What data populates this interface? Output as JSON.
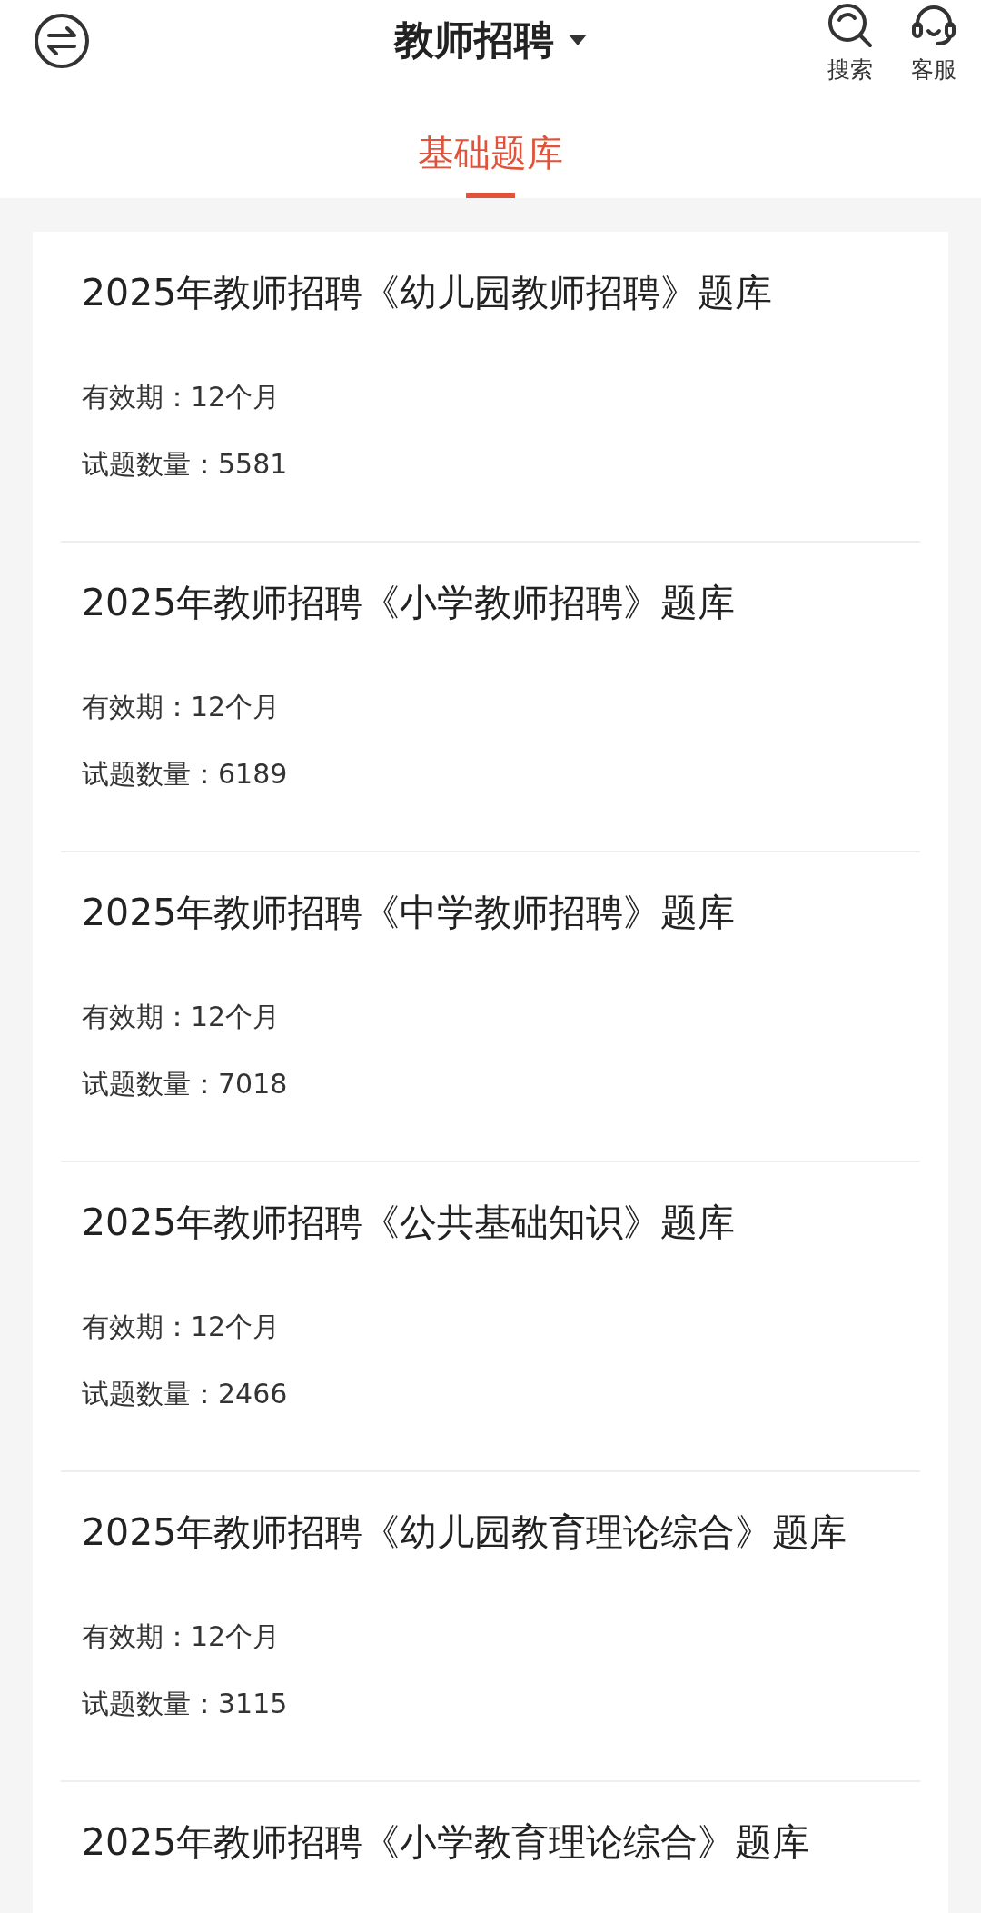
{
  "header": {
    "title": "教师招聘",
    "actions": [
      {
        "kind": "search",
        "label": "搜索"
      },
      {
        "kind": "service",
        "label": "客服"
      }
    ]
  },
  "tabs": [
    {
      "label": "基础题库",
      "selected": true
    }
  ],
  "banks": [
    {
      "title": "2025年教师招聘《幼儿园教师招聘》题库",
      "validity": "有效期：12个月",
      "count": "试题数量：5581"
    },
    {
      "title": "2025年教师招聘《小学教师招聘》题库",
      "validity": "有效期：12个月",
      "count": "试题数量：6189"
    },
    {
      "title": "2025年教师招聘《中学教师招聘》题库",
      "validity": "有效期：12个月",
      "count": "试题数量：7018"
    },
    {
      "title": "2025年教师招聘《公共基础知识》题库",
      "validity": "有效期：12个月",
      "count": "试题数量：2466"
    },
    {
      "title": "2025年教师招聘《幼儿园教育理论综合》题库",
      "validity": "有效期：12个月",
      "count": "试题数量：3115"
    },
    {
      "title": "2025年教师招聘《小学教育理论综合》题库"
    }
  ]
}
